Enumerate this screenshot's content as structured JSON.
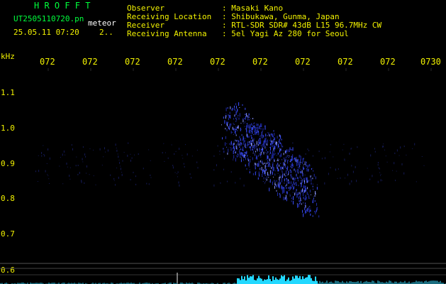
{
  "header": {
    "app_title": "H R O F F T",
    "filename": "UT2505110720.pn",
    "event_label": "meteor",
    "timestamp": "25.05.11 07:20",
    "count_label": "2..",
    "info_labels": [
      "Observer",
      "Receiving Location",
      "Receiver",
      "Receiving Antenna"
    ],
    "info_values": [
      ": Masaki Kano",
      ": Shibukawa, Gunma, Japan",
      ": RTL-SDR SDR# 43dB L15 96.7MHz CW",
      ": 5el Yagi Az 280 for Seoul"
    ]
  },
  "axes": {
    "y_unit": "kHz",
    "y_ticks": [
      "1.1",
      "1.0",
      "0.9",
      "0.8",
      "0.7",
      "0.6"
    ],
    "x_ticks": [
      "072",
      "072",
      "072",
      "072",
      "072",
      "072",
      "072",
      "072",
      "072",
      "0730"
    ]
  },
  "colors": {
    "header_green": "#00ff3c",
    "tick_yellow": "#f2f200",
    "signal_blue": "#3a4dff",
    "level_cyan": "#22d8ff"
  }
}
